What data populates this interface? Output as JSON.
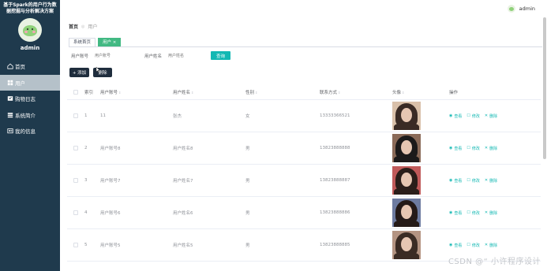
{
  "app": {
    "title": "基于Spark的用户行为数据挖掘与分析解决方案",
    "username": "admin"
  },
  "sidebar": {
    "items": [
      {
        "label": "首页",
        "icon": "home-icon",
        "active": false
      },
      {
        "label": "用户",
        "icon": "grid-icon",
        "active": true
      },
      {
        "label": "购物日志",
        "icon": "log-icon",
        "active": false
      },
      {
        "label": "系统简介",
        "icon": "list-icon",
        "active": false
      },
      {
        "label": "我的信息",
        "icon": "profile-icon",
        "active": false
      }
    ]
  },
  "header": {
    "username": "admin"
  },
  "breadcrumb": {
    "home": "首页",
    "current": "用户"
  },
  "tabs": [
    {
      "label": "系统首页",
      "active": false
    },
    {
      "label": "用户 ×",
      "active": true
    }
  ],
  "search": {
    "account_label": "用户账号",
    "account_placeholder": "用户账号",
    "name_label": "用户姓名",
    "name_placeholder": "用户姓名",
    "search_button": "查询"
  },
  "actions": {
    "add": "+ 添加",
    "delete": "删除"
  },
  "table": {
    "headers": {
      "index": "索引",
      "account": "用户账号",
      "name": "用户姓名",
      "sex": "性别",
      "phone": "联系方式",
      "photo": "头像",
      "ops": "操作"
    },
    "ops": {
      "view": "查看",
      "edit": "修改",
      "delete": "删除"
    },
    "rows": [
      {
        "index": "1",
        "account": "11",
        "name": "张杰",
        "sex": "女",
        "phone": "13333366521",
        "photo_colors": [
          "#3a2b25",
          "#d9c0a9"
        ]
      },
      {
        "index": "2",
        "account": "用户账号8",
        "name": "用户姓名8",
        "sex": "男",
        "phone": "13823888888",
        "photo_colors": [
          "#1c1a1a",
          "#8a6a58"
        ]
      },
      {
        "index": "3",
        "account": "用户账号7",
        "name": "用户姓名7",
        "sex": "男",
        "phone": "13823888887",
        "photo_colors": [
          "#2a1e1a",
          "#c05a5a"
        ]
      },
      {
        "index": "4",
        "account": "用户账号6",
        "name": "用户姓名6",
        "sex": "男",
        "phone": "13823888886",
        "photo_colors": [
          "#241a18",
          "#6d7ba0"
        ]
      },
      {
        "index": "5",
        "account": "用户账号5",
        "name": "用户姓名5",
        "sex": "男",
        "phone": "13823888885",
        "photo_colors": [
          "#3b2c24",
          "#b49482"
        ]
      }
    ]
  },
  "watermark": "CSDN @“ 小许程序设计"
}
